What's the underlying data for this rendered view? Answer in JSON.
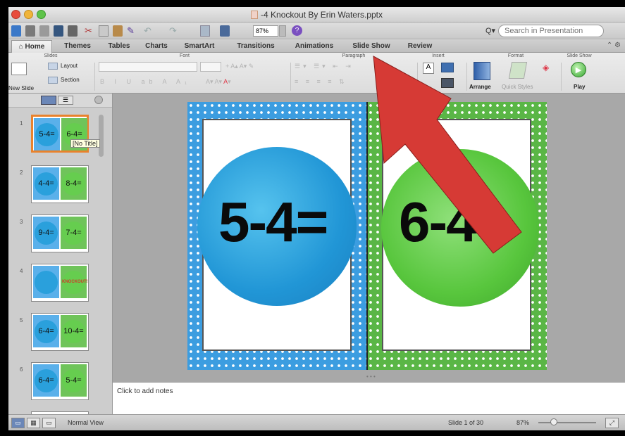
{
  "window": {
    "title": "-4 Knockout By Erin Waters.pptx"
  },
  "toolbar": {
    "zoom_value": "87%",
    "search_placeholder": "Search in Presentation",
    "search_icon": "magnifier-icon"
  },
  "ribbon_tabs": [
    {
      "label": "Home",
      "active": true
    },
    {
      "label": "Themes"
    },
    {
      "label": "Tables"
    },
    {
      "label": "Charts"
    },
    {
      "label": "SmartArt"
    },
    {
      "label": "Transitions"
    },
    {
      "label": "Animations"
    },
    {
      "label": "Slide Show"
    },
    {
      "label": "Review"
    }
  ],
  "ribbon": {
    "groups": {
      "slides": "Slides",
      "font": "Font",
      "paragraph": "Paragraph",
      "insert": "Insert",
      "format": "Format",
      "slide_show": "Slide Show"
    },
    "new_slide": "New Slide",
    "layout": "Layout",
    "section": "Section",
    "arrange": "Arrange",
    "quick_styles": "Quick Styles",
    "play": "Play"
  },
  "sidebar": {
    "tooltip": "[No Title]",
    "slides": [
      {
        "num": "1",
        "left": "5-4=",
        "right": "6-4=",
        "selected": true
      },
      {
        "num": "2",
        "left": "4-4=",
        "right": "8-4="
      },
      {
        "num": "3",
        "left": "9-4=",
        "right": "7-4="
      },
      {
        "num": "4",
        "left": "",
        "right": "KNOCKOUT!"
      },
      {
        "num": "5",
        "left": "6-4=",
        "right": "10-4="
      },
      {
        "num": "6",
        "left": "6-4=",
        "right": "5-4="
      }
    ]
  },
  "slide": {
    "left_expression": "5-4=",
    "right_expression": "6-4=",
    "colors": {
      "blue": "#3c9de0",
      "green": "#5ab646"
    }
  },
  "notes": {
    "placeholder": "Click to add notes"
  },
  "status": {
    "view": "Normal View",
    "slide_position": "Slide 1 of 30",
    "zoom": "87%"
  },
  "overlay": {
    "arrow_color": "#d63a35"
  }
}
